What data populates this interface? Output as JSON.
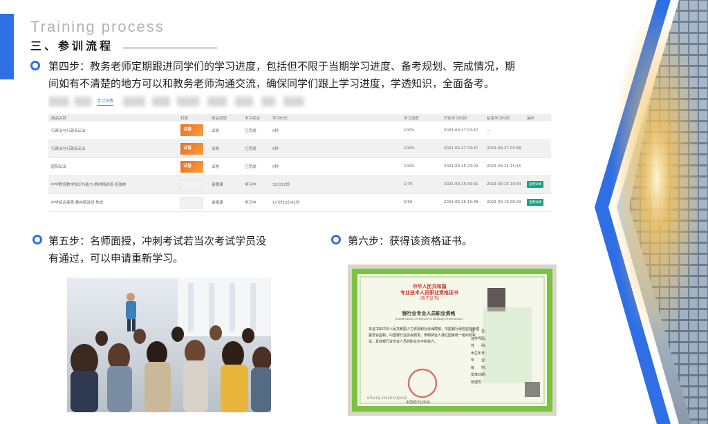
{
  "header": {
    "title_en": "Training process",
    "title_zh": "三、参训流程"
  },
  "step4": {
    "line1": "第四步：教务老师定期跟进同学们的学习进度，包括但不限于当期学习进度、备考规划、完成情况，期",
    "line2": "间如有不清楚的地方可以和教务老师沟通交流，确保同学们跟上学习进度，学透知识，全面备考。"
  },
  "study_table": {
    "active_tab": "学习详情",
    "columns": [
      "商品名称",
      "封面",
      "商品类型",
      "学习状态",
      "学习时长",
      "学习进度",
      "开始学习时间",
      "结束学习时间",
      "操作"
    ],
    "rows": [
      {
        "name": "行政法与行政诉讼法",
        "cover": "试卷",
        "type": "试卷",
        "status": "已完成",
        "duration": "0秒",
        "progress": "100%",
        "start": "2021-09-27 03:47",
        "end": "—",
        "action": ""
      },
      {
        "name": "行政法与行政诉讼法",
        "cover": "试卷",
        "type": "试卷",
        "status": "已完成",
        "duration": "0秒",
        "progress": "100%",
        "start": "2021-09-27 03:47",
        "end": "2021-09-27 03:48",
        "action": ""
      },
      {
        "name": "国际私法",
        "cover": "试卷",
        "type": "试卷",
        "status": "已完成",
        "duration": "0秒",
        "progress": "100%",
        "start": "2021-09-15 23:02",
        "end": "2021-09-24 15:15",
        "action": ""
      },
      {
        "name": "中学教育教学知识与能力-教材精讲班-张瀚林",
        "cover": "",
        "type": "录播课",
        "status": "学习中",
        "duration": "32分22秒",
        "progress": "1/79",
        "start": "2021-09-15 09:31",
        "end": "2021-09-15 19:43",
        "action": "查看详情"
      },
      {
        "name": "中学综合素质-教材精讲班-陈龙",
        "cover": "",
        "type": "录播课",
        "status": "学习中",
        "duration": "1小时13分41秒",
        "progress": "6/96",
        "start": "2021-08-26 19:48",
        "end": "2021-09-15 09:33",
        "action": "查看详情"
      }
    ]
  },
  "step5": {
    "line1": "第五步：名师面授，冲刺考试若当次考试学员没",
    "line2": "有通过，可以申请重新学习。"
  },
  "step6": {
    "text": "第六步：获得该资格证书。"
  },
  "certificate": {
    "title1": "中华人民共和国",
    "title2": "专业技术人员职业资格证书",
    "subtitle": "(电子证书)",
    "qualification": "银行业专业人员职业资格",
    "qualification_en": "Qualification Certificate of Banking Professional",
    "body": "本证书由中华人民共和国人力资源和社会保障部、中国银行保险监督管理委员会监制，中国银行业协会颁发。表明持证人通过国家统一组织的考试，具有银行业专业人员的职业水平和能力。",
    "fields": [
      "姓　　名：",
      "证件号码：",
      "性　　别：",
      "出生年月：",
      "专　　业：",
      "级　　别：",
      "批准日期：",
      "管理号："
    ],
    "issuer": "中国银行业协会",
    "footer": "NTB01号 2021年12月20日"
  },
  "colors": {
    "accent_blue": "#2f6fe6",
    "tab_blue": "#2f8ad3",
    "cert_border_green": "#7cc242",
    "action_green": "#17a084",
    "cover_orange": "#f26b1d"
  }
}
